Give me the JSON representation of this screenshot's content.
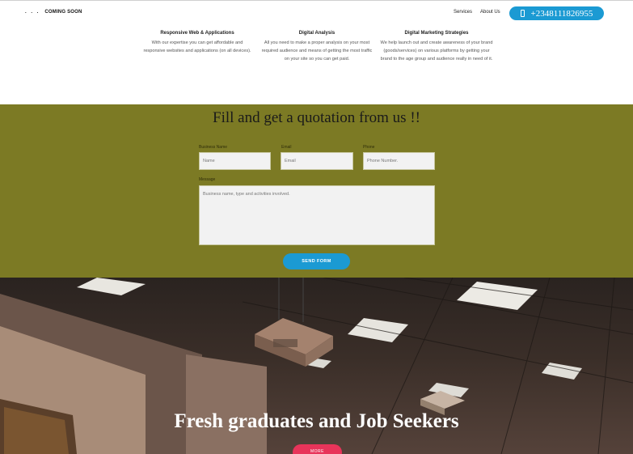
{
  "header": {
    "logo_dots": ". . .",
    "logo_text": "COMING SOON",
    "nav": {
      "services": "Services",
      "about": "About Us"
    },
    "phone": "+2348111826955"
  },
  "services": [
    {
      "title": "Responsive Web & Applications",
      "text": "With our expertise you can get affordable and responsive websites and applications (on all devices)."
    },
    {
      "title": "Digital Analysis",
      "text": "All you need to make a proper analysis on your most required audience and means of getting the most traffic on your site so you can get paid."
    },
    {
      "title": "Digital Marketing Strategies",
      "text": "We help launch out and create awareness of your brand (goods/services) on various platforms by getting your brand to the age group and audience really in need of it."
    }
  ],
  "quote": {
    "title": "Fill and get a quotation from us !!",
    "labels": {
      "business_name": "Business Name",
      "email": "Email",
      "phone": "Phone",
      "message": "Message"
    },
    "placeholders": {
      "name": "Name",
      "email": "Email",
      "phone": "Phone Number.",
      "message": "Business name, type and activities involved."
    },
    "send_label": "SEND FORM"
  },
  "hero": {
    "title": "Fresh graduates and Job Seekers",
    "more_label": "MORE"
  },
  "colors": {
    "accent_blue": "#1b9ad3",
    "quote_bg": "#7c7a24",
    "more_pink": "#e8345a"
  }
}
